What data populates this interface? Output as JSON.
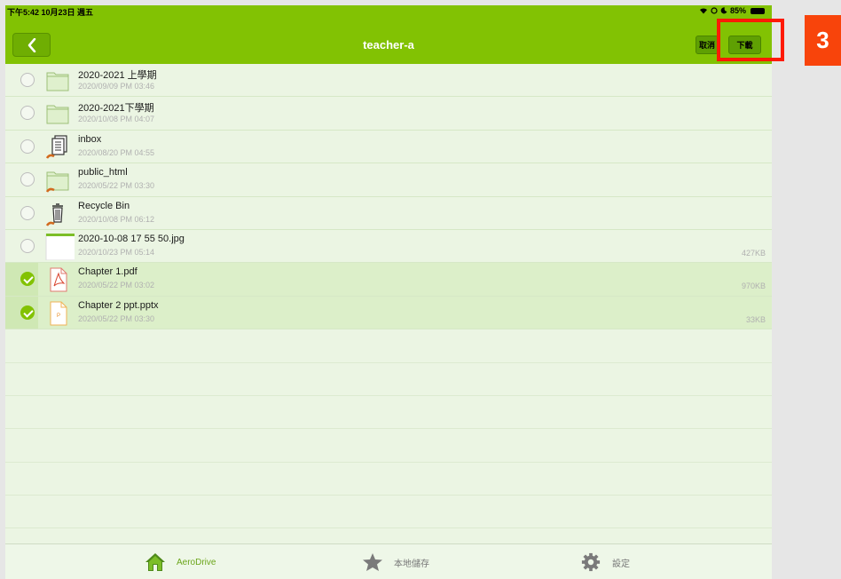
{
  "status_bar": {
    "time": "下午5:42",
    "date": "10月23日 週五",
    "battery": "85%"
  },
  "nav": {
    "title": "teacher-a",
    "cancel_label": "取消",
    "download_label": "下載"
  },
  "files": [
    {
      "name": "2020-2021 上學期",
      "date": "2020/09/09 PM 03:46",
      "size": "",
      "icon": "folder-icon",
      "selected": false
    },
    {
      "name": "2020-2021下學期",
      "date": "2020/10/08 PM 04:07",
      "size": "",
      "icon": "folder-icon",
      "selected": false
    },
    {
      "name": "inbox",
      "date": "2020/08/20 PM 04:55",
      "size": "",
      "icon": "inbox-shared-icon",
      "selected": false
    },
    {
      "name": "public_html",
      "date": "2020/05/22 PM 03:30",
      "size": "",
      "icon": "shared-folder-icon",
      "selected": false
    },
    {
      "name": "Recycle Bin",
      "date": "2020/10/08 PM 06:12",
      "size": "",
      "icon": "trash-icon",
      "selected": false
    },
    {
      "name": "2020-10-08 17 55 50.jpg",
      "date": "2020/10/23 PM 05:14",
      "size": "427KB",
      "icon": "image-thumbnail-icon",
      "selected": false
    },
    {
      "name": "Chapter 1.pdf",
      "date": "2020/05/22 PM 03:02",
      "size": "970KB",
      "icon": "pdf-file-icon",
      "selected": true
    },
    {
      "name": "Chapter 2 ppt.pptx",
      "date": "2020/05/22 PM 03:30",
      "size": "33KB",
      "icon": "pptx-file-icon",
      "selected": true
    }
  ],
  "tabs": [
    {
      "label": "AeroDrive",
      "icon": "home-icon",
      "active": true
    },
    {
      "label": "本地儲存",
      "icon": "star-icon",
      "active": false
    },
    {
      "label": "設定",
      "icon": "gear-icon",
      "active": false
    }
  ],
  "annotation": {
    "step_number": "3",
    "highlight_color": "#ff1a05",
    "badge_color": "#f8440b"
  },
  "colors": {
    "accent": "#82c203",
    "list_background": "#ebf5e3"
  }
}
